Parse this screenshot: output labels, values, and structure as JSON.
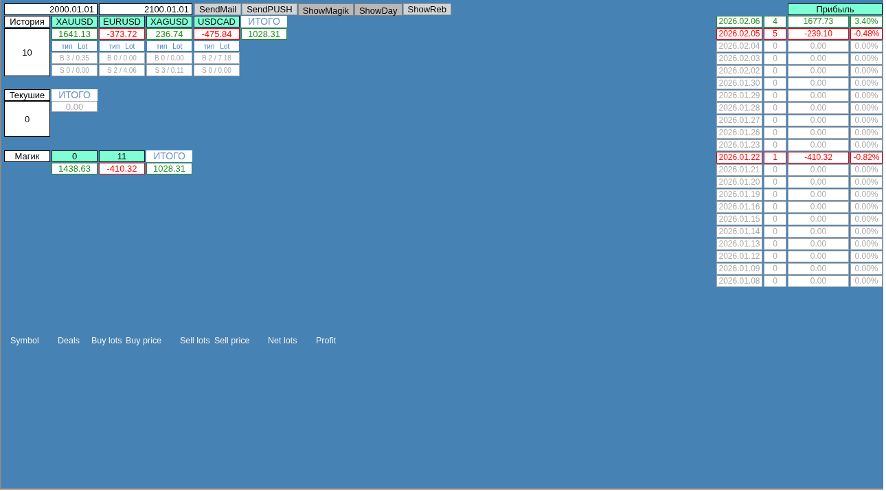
{
  "date_from": "2000.01.01",
  "date_to": "2100.01.01",
  "buttons": [
    {
      "label": "SendMail",
      "pressed": false
    },
    {
      "label": "SendPUSH",
      "pressed": false
    },
    {
      "label": "ShowMagik",
      "pressed": true
    },
    {
      "label": "ShowDay",
      "pressed": true
    },
    {
      "label": "ShowReb",
      "pressed": false
    }
  ],
  "history": {
    "title": "История",
    "count": "10",
    "symbols": [
      {
        "symbol": "XAUUSD",
        "profit": "1641.13",
        "color": "#228b22",
        "type_label": "тип",
        "lot_label": "Lot",
        "buy": "B 3 / 0.35",
        "sell": "S 0 / 0.00"
      },
      {
        "symbol": "EURUSD",
        "profit": "-373.72",
        "color": "#ff0000",
        "type_label": "тип",
        "lot_label": "Lot",
        "buy": "B 0 / 0.00",
        "sell": "S 2 / 4.06"
      },
      {
        "symbol": "XAGUSD",
        "profit": "236.74",
        "color": "#228b22",
        "type_label": "тип",
        "lot_label": "Lot",
        "buy": "B 0 / 0.00",
        "sell": "S 3 / 0.11"
      },
      {
        "symbol": "USDCAD",
        "profit": "-475.84",
        "color": "#ff0000",
        "type_label": "тип",
        "lot_label": "Lot",
        "buy": "B 2 / 7.18",
        "sell": "S 0 / 0.00"
      }
    ],
    "total": {
      "label": "ИТОГО",
      "profit": "1028.31",
      "color": "#228b22"
    }
  },
  "current": {
    "title": "Текушие",
    "count": "0",
    "total": {
      "label": "ИТОГО",
      "profit": "0.00",
      "color": "#a9a9a9"
    }
  },
  "magic": {
    "title": "Магик",
    "items": [
      {
        "magic": "0",
        "profit": "1438.63",
        "color": "#228b22"
      },
      {
        "magic": "11",
        "profit": "-410.32",
        "color": "#ff0000"
      }
    ],
    "total": {
      "label": "ИТОГО",
      "profit": "1028.31",
      "color": "#228b22"
    }
  },
  "daily": {
    "header": "Прибыль",
    "rows": [
      {
        "date": "2026.02.06",
        "deals": "4",
        "profit": "1677.73",
        "percent": "3.40%",
        "color": "#228b22"
      },
      {
        "date": "2026.02.05",
        "deals": "5",
        "profit": "-239.10",
        "percent": "-0.48%",
        "color": "#ff0000"
      },
      {
        "date": "2026.02.04",
        "deals": "0",
        "profit": "0.00",
        "percent": "0.00%",
        "color": "#a9a9a9"
      },
      {
        "date": "2026.02.03",
        "deals": "0",
        "profit": "0.00",
        "percent": "0.00%",
        "color": "#a9a9a9"
      },
      {
        "date": "2026.02.02",
        "deals": "0",
        "profit": "0.00",
        "percent": "0.00%",
        "color": "#a9a9a9"
      },
      {
        "date": "2026.01.30",
        "deals": "0",
        "profit": "0.00",
        "percent": "0.00%",
        "color": "#a9a9a9"
      },
      {
        "date": "2026.01.29",
        "deals": "0",
        "profit": "0.00",
        "percent": "0.00%",
        "color": "#a9a9a9"
      },
      {
        "date": "2026.01.28",
        "deals": "0",
        "profit": "0.00",
        "percent": "0.00%",
        "color": "#a9a9a9"
      },
      {
        "date": "2026.01.27",
        "deals": "0",
        "profit": "0.00",
        "percent": "0.00%",
        "color": "#a9a9a9"
      },
      {
        "date": "2026.01.26",
        "deals": "0",
        "profit": "0.00",
        "percent": "0.00%",
        "color": "#a9a9a9"
      },
      {
        "date": "2026.01.23",
        "deals": "0",
        "profit": "0.00",
        "percent": "0.00%",
        "color": "#a9a9a9"
      },
      {
        "date": "2026.01.22",
        "deals": "1",
        "profit": "-410.32",
        "percent": "-0.82%",
        "color": "#ff0000"
      },
      {
        "date": "2026.01.21",
        "deals": "0",
        "profit": "0.00",
        "percent": "0.00%",
        "color": "#a9a9a9"
      },
      {
        "date": "2026.01.20",
        "deals": "0",
        "profit": "0.00",
        "percent": "0.00%",
        "color": "#a9a9a9"
      },
      {
        "date": "2026.01.19",
        "deals": "0",
        "profit": "0.00",
        "percent": "0.00%",
        "color": "#a9a9a9"
      },
      {
        "date": "2026.01.16",
        "deals": "0",
        "profit": "0.00",
        "percent": "0.00%",
        "color": "#a9a9a9"
      },
      {
        "date": "2026.01.15",
        "deals": "0",
        "profit": "0.00",
        "percent": "0.00%",
        "color": "#a9a9a9"
      },
      {
        "date": "2026.01.14",
        "deals": "0",
        "profit": "0.00",
        "percent": "0.00%",
        "color": "#a9a9a9"
      },
      {
        "date": "2026.01.13",
        "deals": "0",
        "profit": "0.00",
        "percent": "0.00%",
        "color": "#a9a9a9"
      },
      {
        "date": "2026.01.12",
        "deals": "0",
        "profit": "0.00",
        "percent": "0.00%",
        "color": "#a9a9a9"
      },
      {
        "date": "2026.01.09",
        "deals": "0",
        "profit": "0.00",
        "percent": "0.00%",
        "color": "#a9a9a9"
      },
      {
        "date": "2026.01.08",
        "deals": "0",
        "profit": "0.00",
        "percent": "0.00%",
        "color": "#a9a9a9"
      }
    ]
  },
  "columns": [
    "Symbol",
    "Deals",
    "Buy lots",
    "Buy price",
    "Sell lots",
    "Sell price",
    "Net lots",
    "Profit"
  ]
}
